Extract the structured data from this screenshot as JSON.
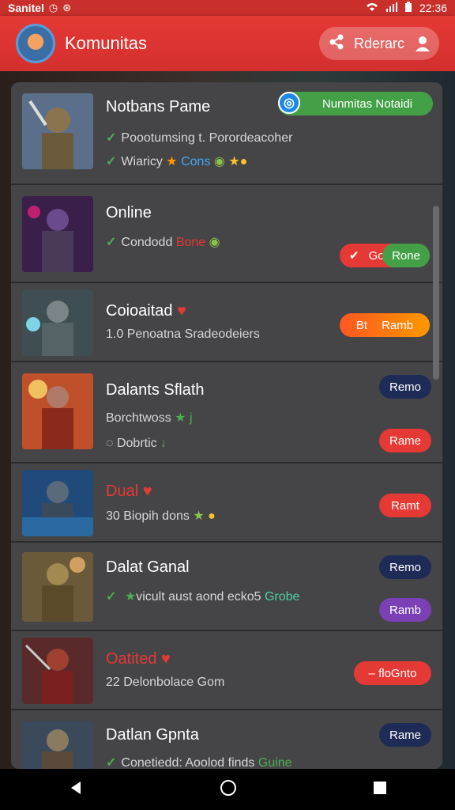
{
  "status_bar": {
    "carrier": "Sanitel",
    "time": "22:36"
  },
  "header": {
    "title": "Komunitas",
    "pill_label": "Rderarc"
  },
  "rows": [
    {
      "title": "Notbans Pame",
      "line1": "Poootumsing t. Porordeacoher",
      "line2": "Wiaricy",
      "line2b": "Cons",
      "badge": "Nunmitas Notaidi"
    },
    {
      "title": "Online",
      "line1": "Condodd",
      "line1b": "Bone",
      "pill_left": "Go",
      "pill_right": "Rone"
    },
    {
      "title": "Coioaitad",
      "line1": "1.0 Penoatna Sradeodeiers",
      "pill_left": "Bt",
      "pill_right": "Ramb"
    },
    {
      "title": "Dalants Sflath",
      "line1": "Borchtwoss",
      "line2": "Dobrtic",
      "pill_top": "Remo",
      "pill_bottom": "Rame"
    },
    {
      "title": "Dual",
      "line1": "30 Biopih dons",
      "pill": "Ramt"
    },
    {
      "title": "Dalat Ganal",
      "line1": "vicult aust aond ecko5",
      "line1b": "Grobe",
      "pill_top": "Remo",
      "pill_bottom": "Ramb"
    },
    {
      "title": "Oatited",
      "line1": "22 Delonbolace Gom",
      "pill": "– floGnto"
    },
    {
      "title": "Datlan Gpnta",
      "line1": "Conetiedd: Aoolod finds",
      "line1b": "Guine",
      "pill_top": "Rame"
    }
  ],
  "colors": {
    "accent_red": "#e53935",
    "check_green": "#4caf50",
    "navy": "#1f2b57",
    "purple": "#7b3fb6"
  },
  "icons": [
    "wifi-icon",
    "signal-icon",
    "battery-icon",
    "share-icon",
    "user-icon",
    "check-icon",
    "star-icon",
    "heart-icon",
    "back-icon",
    "home-icon",
    "recents-icon"
  ]
}
